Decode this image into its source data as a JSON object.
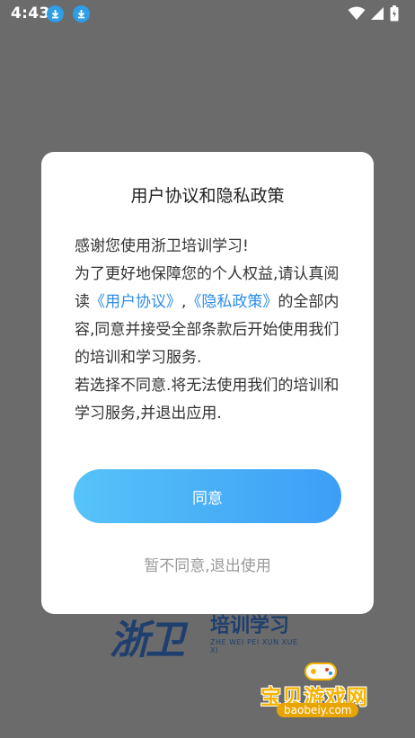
{
  "status_bar": {
    "time": "4:43",
    "icons": [
      "download-icon",
      "download-icon",
      "wifi-icon",
      "signal-icon",
      "battery-icon"
    ]
  },
  "background": {
    "logo_mark": "浙卫",
    "logo_title": "培训学习",
    "logo_subtitle": "ZHE WEI PEI XUN XUE XI"
  },
  "watermark": {
    "text": "宝贝游戏网",
    "url": "baobeiy.com"
  },
  "dialog": {
    "title": "用户协议和隐私政策",
    "body_intro": "感谢您使用浙卫培训学习!",
    "body_p2_a": "为了更好地保障您的个人权益,请认真阅读",
    "link_user_agreement": "《用户协议》",
    "body_sep": ",",
    "link_privacy_policy": "《隐私政策》",
    "body_p2_b": "的全部内容,同意并接受全部条款后开始使用我们的培训和学习服务.",
    "body_p3": "若选择不同意.将无法使用我们的培训和学习服务,并退出应用.",
    "agree_label": "同意",
    "decline_label": "暂不同意,退出使用"
  },
  "colors": {
    "overlay": "#6b6b6b",
    "accent": "#3d9ef6",
    "link": "#2d8de8",
    "muted": "#9a9a9a"
  }
}
